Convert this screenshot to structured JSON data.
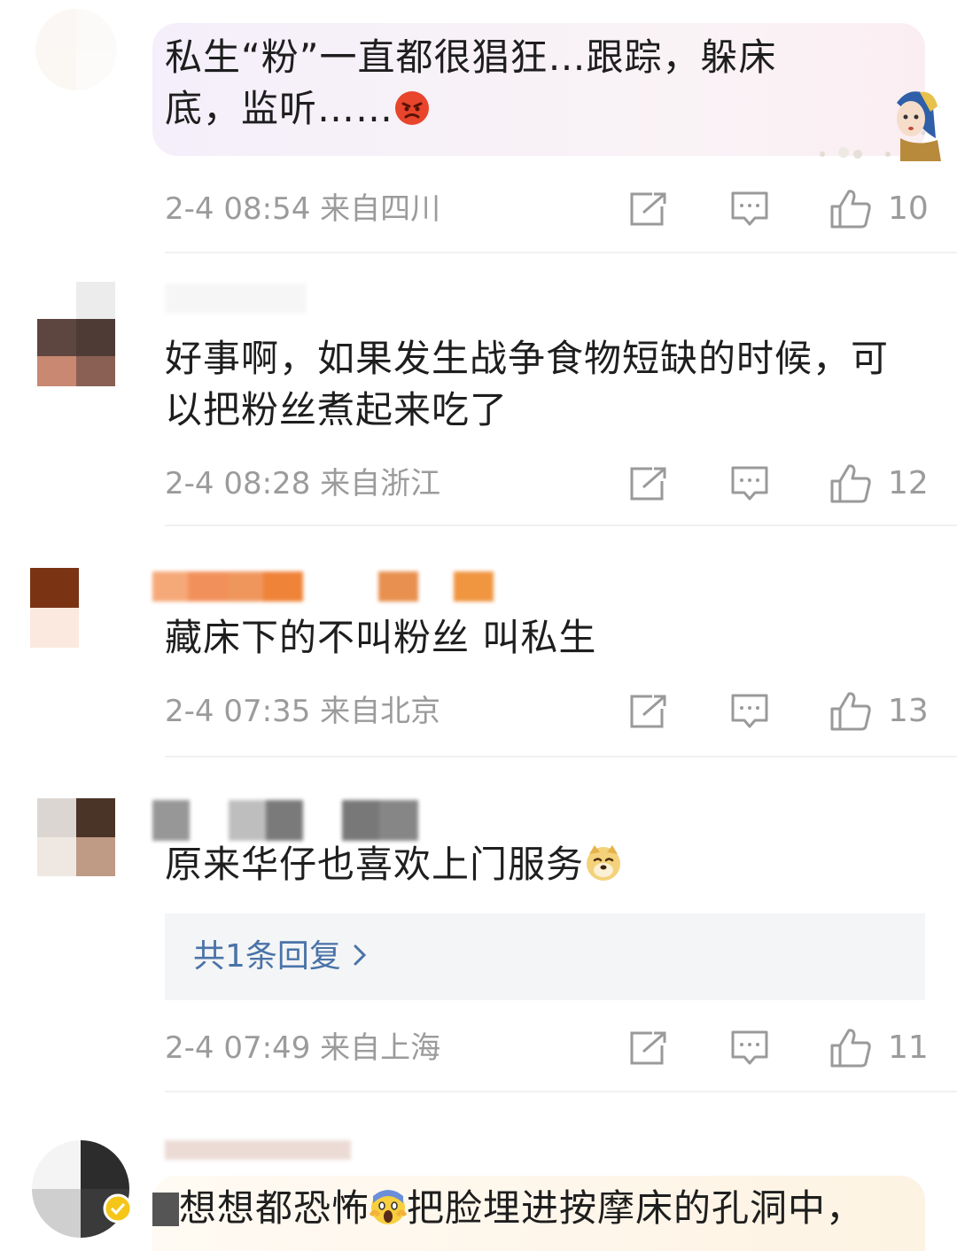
{
  "comments": [
    {
      "text_line1": "私生“粉”一直都很猖狂…跟踪，躲床",
      "text_line2": "底，监听……",
      "emoji": "angry-face-icon",
      "time": "2-4 08:54",
      "location": "来自四川",
      "likes": "10"
    },
    {
      "text_line1": "好事啊，如果发生战争食物短缺的时候，可",
      "text_line2": "以把粉丝煮起来吃了",
      "time": "2-4 08:28",
      "location": "来自浙江",
      "likes": "12"
    },
    {
      "text_line1": "藏床下的不叫粉丝 叫私生",
      "time": "2-4 07:35",
      "location": "来自北京",
      "likes": "13"
    },
    {
      "text_line1": "原来华仔也喜欢上门服务",
      "emoji": "doge-icon",
      "replies": "共1条回复",
      "time": "2-4 07:49",
      "location": "来自上海",
      "likes": "11"
    },
    {
      "text_line1": "想想都恐怖",
      "text_line1b": "把脸埋进按摩床的孔洞中，",
      "emoji": "scream-face-icon"
    }
  ],
  "colors": {
    "meta_gray": "#9b9b9b",
    "reply_link": "#4a73a8",
    "bubble": "#f4effa"
  }
}
